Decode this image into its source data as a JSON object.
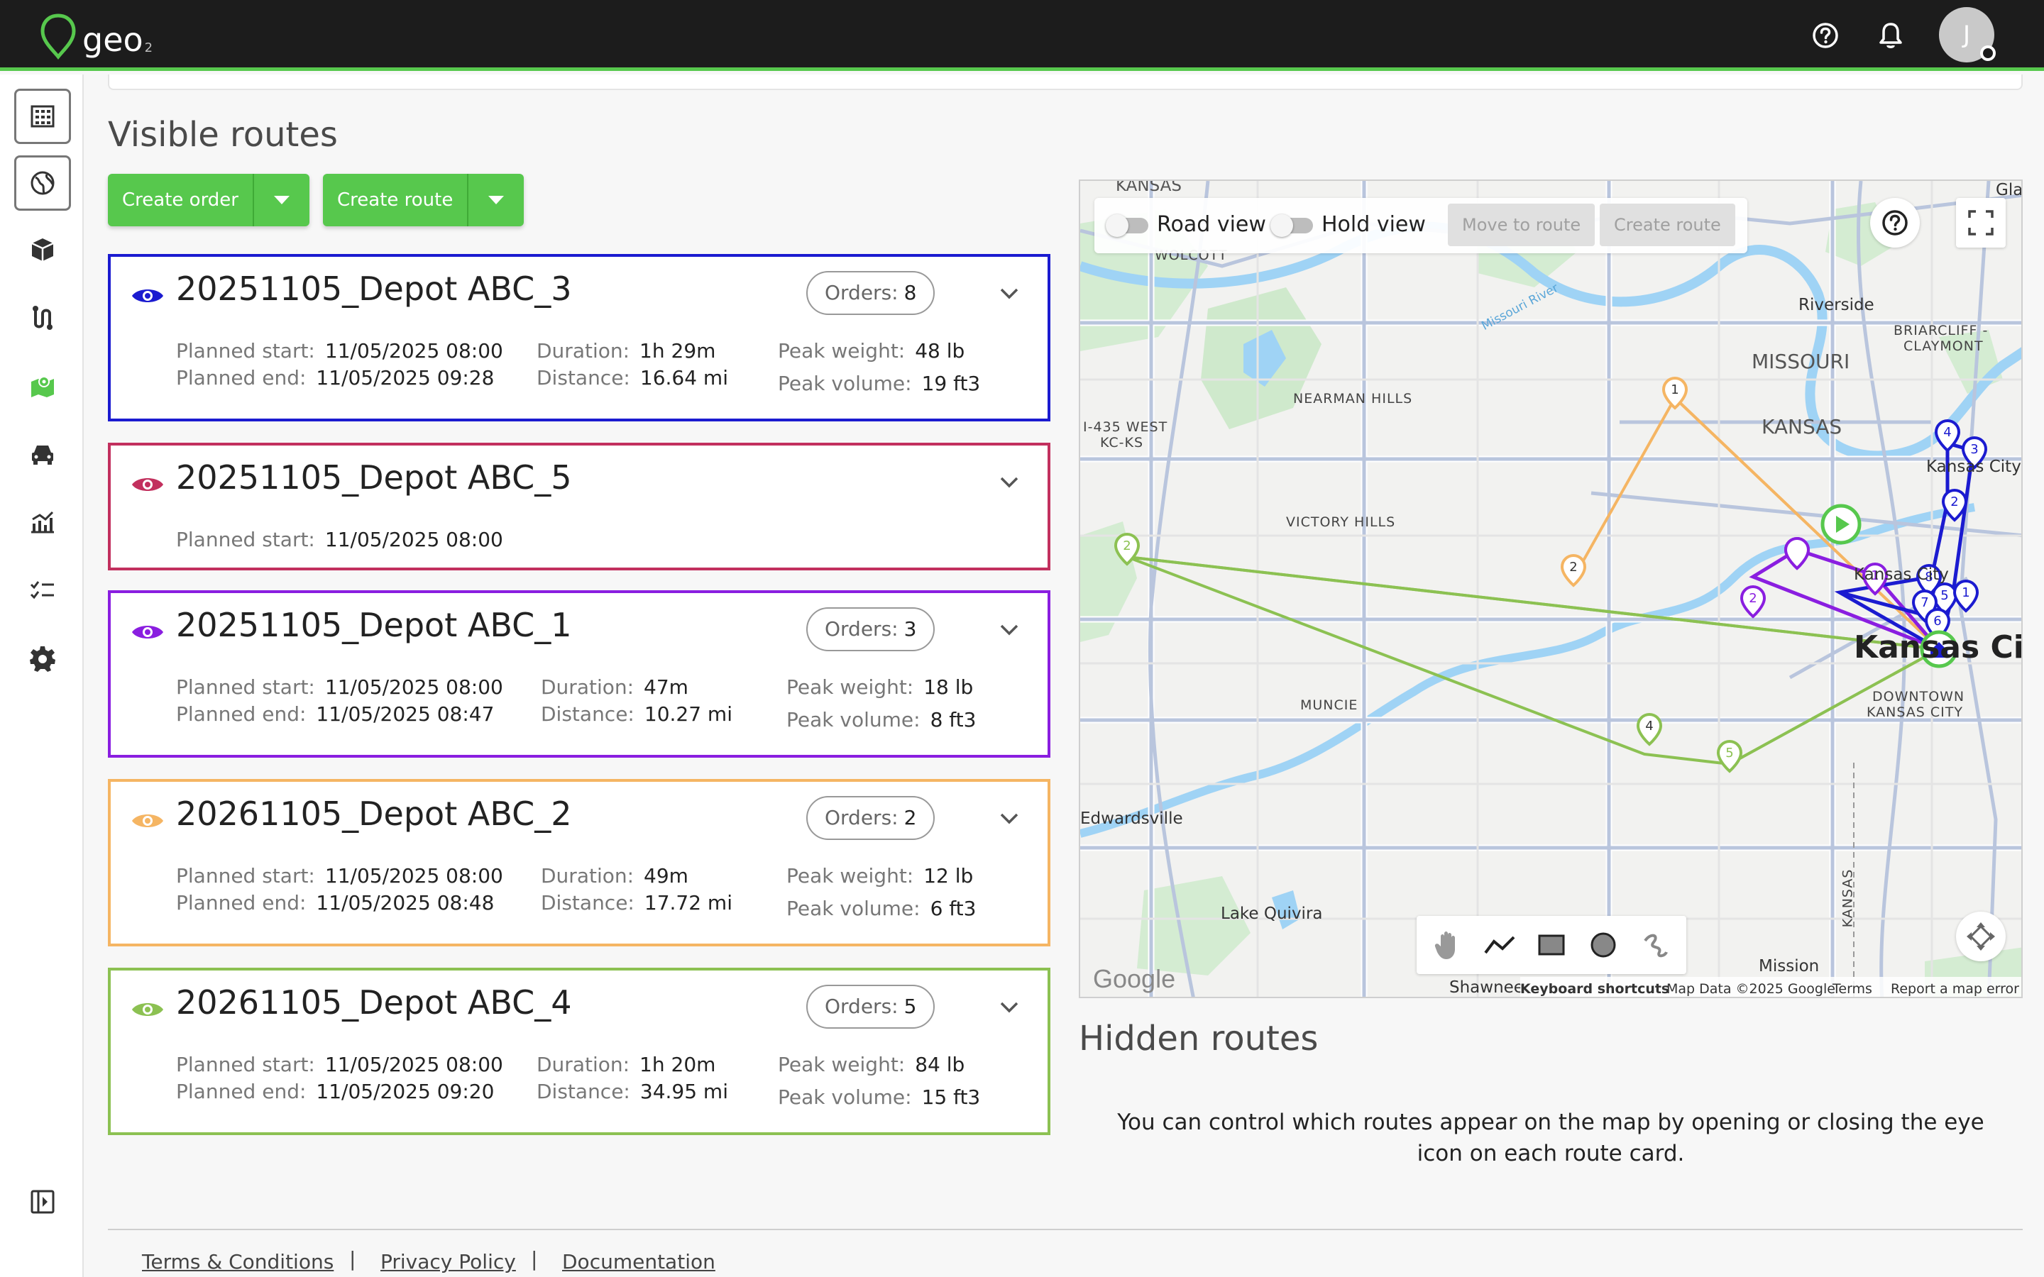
{
  "app": {
    "logo_text": "geo",
    "logo_sub": "2",
    "avatar_initial": "J"
  },
  "colors": {
    "brand_green": "#57c84d",
    "route_blue": "#1b1bd0",
    "route_pink": "#c2305e",
    "route_purple": "#8a1ee0",
    "route_orange": "#f5b563",
    "route_green": "#8cc152"
  },
  "visible_routes": {
    "title": "Visible routes",
    "create_order_label": "Create order",
    "create_route_label": "Create route"
  },
  "routes": [
    {
      "name": "20251105_Depot ABC_3",
      "color": "#1b1bd0",
      "orders_label": "Orders:",
      "orders": "8",
      "planned_start_label": "Planned start:",
      "planned_start": "11/05/2025 08:00",
      "planned_end_label": "Planned end:",
      "planned_end": "11/05/2025 09:28",
      "duration_label": "Duration:",
      "duration": "1h 29m",
      "distance_label": "Distance:",
      "distance": "16.64 mi",
      "peak_weight_label": "Peak weight:",
      "peak_weight": "48 lb",
      "peak_volume_label": "Peak volume:",
      "peak_volume": "19 ft3"
    },
    {
      "name": "20251105_Depot ABC_5",
      "color": "#c2305e",
      "planned_start_label": "Planned start:",
      "planned_start": "11/05/2025 08:00"
    },
    {
      "name": "20251105_Depot ABC_1",
      "color": "#8a1ee0",
      "orders_label": "Orders:",
      "orders": "3",
      "planned_start_label": "Planned start:",
      "planned_start": "11/05/2025 08:00",
      "planned_end_label": "Planned end:",
      "planned_end": "11/05/2025 08:47",
      "duration_label": "Duration:",
      "duration": "47m",
      "distance_label": "Distance:",
      "distance": "10.27 mi",
      "peak_weight_label": "Peak weight:",
      "peak_weight": "18 lb",
      "peak_volume_label": "Peak volume:",
      "peak_volume": "8 ft3"
    },
    {
      "name": "20261105_Depot ABC_2",
      "color": "#f5b563",
      "orders_label": "Orders:",
      "orders": "2",
      "planned_start_label": "Planned start:",
      "planned_start": "11/05/2025 08:00",
      "planned_end_label": "Planned end:",
      "planned_end": "11/05/2025 08:48",
      "duration_label": "Duration:",
      "duration": "49m",
      "distance_label": "Distance:",
      "distance": "17.72 mi",
      "peak_weight_label": "Peak weight:",
      "peak_weight": "12 lb",
      "peak_volume_label": "Peak volume:",
      "peak_volume": "6 ft3"
    },
    {
      "name": "20261105_Depot ABC_4",
      "color": "#8cc152",
      "orders_label": "Orders:",
      "orders": "5",
      "planned_start_label": "Planned start:",
      "planned_start": "11/05/2025 08:00",
      "planned_end_label": "Planned end:",
      "planned_end": "11/05/2025 09:20",
      "duration_label": "Duration:",
      "duration": "1h 20m",
      "distance_label": "Distance:",
      "distance": "34.95 mi",
      "peak_weight_label": "Peak weight:",
      "peak_weight": "84 lb",
      "peak_volume_label": "Peak volume:",
      "peak_volume": "15 ft3"
    }
  ],
  "map": {
    "road_view_label": "Road view",
    "hold_view_label": "Hold view",
    "move_to_route_label": "Move to route",
    "create_route_label": "Create route",
    "places": {
      "wolcott": "WOLCOTT",
      "riverside": "Riverside",
      "briarcliff": "BRIARCLIFF -",
      "claymont": "CLAYMONT",
      "missouri": "MISSOURI",
      "kansas": "KANSAS",
      "nearman": "NEARMAN HILLS",
      "i435": "I-435 WEST",
      "kcks": "KC-KS",
      "victory": "VICTORY HILLS",
      "kansas_city_small": "Kansas City",
      "kansas_city_big": "Kansas City",
      "muncie": "MUNCIE",
      "downtown": "DOWNTOWN",
      "downtown2": "KANSAS CITY",
      "edwardsville": "Edwardsville",
      "lake_quivira": "Lake Quivira",
      "shawnee": "Shawnee",
      "mission": "Mission",
      "missouri_river": "Missouri River",
      "kansas_vertical": "KANSAS",
      "glad": "Glad",
      "kansas_top": "KANSAS"
    },
    "attribution": {
      "google": "Google",
      "keyboard": "Keyboard shortcuts",
      "map_data": "Map Data ©2025 Google",
      "terms": "Terms",
      "report": "Report a map error"
    }
  },
  "hidden_routes": {
    "title": "Hidden routes",
    "hint": "You can control which routes appear on the map by opening or closing the eye icon on each route card."
  },
  "footer": {
    "terms": "Terms & Conditions",
    "privacy": "Privacy Policy",
    "documentation": "Documentation",
    "sep": "|"
  },
  "icons": {
    "help": "help-circle-icon",
    "notifications": "bell-icon",
    "nav": [
      "building-icon",
      "globe-icon",
      "package-icon",
      "route-icon",
      "map-icon",
      "vehicle-icon",
      "analytics-icon",
      "checklist-icon",
      "settings-icon",
      "collapse-sidebar-icon"
    ]
  }
}
